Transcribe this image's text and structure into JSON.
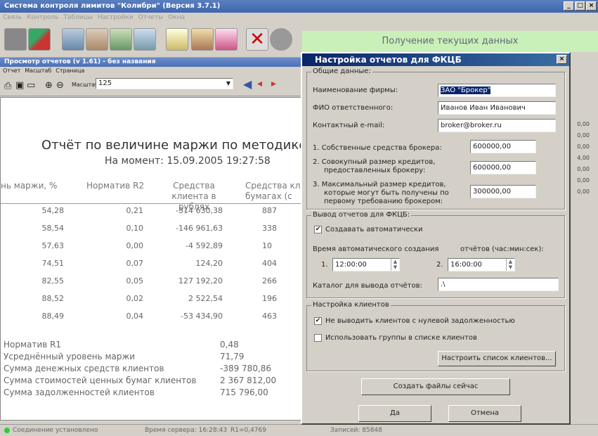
{
  "app": {
    "title": "Система контроля лимитов \"Колибри\" (Версия 3.7.1)"
  },
  "menu": [
    "Связь",
    "Контроль",
    "Таблицы",
    "Настройки",
    "Отчеты",
    "Окна"
  ],
  "status_message": "Получение текущих данных",
  "report_window": {
    "title": "Просмотр отчетов (v 1.61) - без названия",
    "menu": [
      "Отчет",
      "Масштаб",
      "Страница"
    ],
    "zoom_label": "Масштаб",
    "zoom_value": "125",
    "report_title": "Отчёт по величине маржи по методике Ф",
    "report_subtitle": "На момент: 15.09.2005 19:27:58",
    "columns": [
      "нь маржи, %",
      "Норматив R2",
      "Средства клиента в рублях",
      "Средства кл в бумагах (с"
    ],
    "rows": [
      [
        "54,28",
        "0,21",
        "-314 630,38",
        "887"
      ],
      [
        "58,54",
        "0,10",
        "-146 961,63",
        "338"
      ],
      [
        "57,63",
        "0,00",
        "-4 592,89",
        "10"
      ],
      [
        "74,51",
        "0,07",
        "124,20",
        "404"
      ],
      [
        "82,55",
        "0,05",
        "127 192,20",
        "266"
      ],
      [
        "88,52",
        "0,02",
        "2 522,54",
        "196"
      ],
      [
        "88,49",
        "0,04",
        "-53 434,90",
        "463"
      ]
    ],
    "summary": [
      {
        "label": "Норматив R1",
        "value": "0,48"
      },
      {
        "label": "Усреднённый уровень маржи",
        "value": "71,79"
      },
      {
        "label": "Сумма денежных средств клиентов",
        "value": "-389 780,86"
      },
      {
        "label": "Сумма стоимостей ценных бумаг клиентов",
        "value": "2 367 812,00"
      },
      {
        "label": "Сумма задолженностей клиентов",
        "value": "715 796,00"
      }
    ]
  },
  "side_values": [
    "0,00",
    "0,00",
    "0,00",
    "4,00",
    "0,00",
    "0,00",
    "0,00"
  ],
  "footer": {
    "connection": "Соединение установлено",
    "server_time": "Время сервера: 16:28:43",
    "r1": "R1=0,4769",
    "records": "Записей: 85848"
  },
  "dialog": {
    "title": "Настройка отчетов для ФКЦБ",
    "general_group": "Общие данные:",
    "company_label": "Наименование фирмы:",
    "company_value": "ЗАО \"Брокер\"",
    "responsible_label": "ФИО ответственного:",
    "responsible_value": "Иванов Иван Иванович",
    "email_label": "Контактный e-mail:",
    "email_value": "broker@broker.ru",
    "own_funds_label": "1. Собственные средства брокера:",
    "own_funds_value": "600000,00",
    "credits_label_1": "2. Совокупный размер кредитов,",
    "credits_label_2": "предоставленных брокеру:",
    "credits_value": "600000,00",
    "max_credits_label_1": "3. Максимальный размер кредитов,",
    "max_credits_label_2": "которые могут быть получены по",
    "max_credits_label_3": "первому требованию брокером:",
    "max_credits_value": "300000,00",
    "output_group": "Вывод отчетов для ФКЦБ:",
    "auto_create_label": "Создавать автоматически",
    "auto_create_checked": "✔",
    "time_label": "Время автоматического создания",
    "time_format_label": "отчётов (час:мин:сек):",
    "time1_num": "1.",
    "time1_value": "12:00:00",
    "time2_num": "2.",
    "time2_value": "16:00:00",
    "dir_label": "Каталог для вывода отчётов:",
    "dir_value": ".\\",
    "clients_group": "Настройка клиентов",
    "no_zero_debt_label": "Не выводить клиентов с нулевой задолженностью",
    "no_zero_debt_checked": "✔",
    "use_groups_label": "Использовать группы в списке клиентов",
    "use_groups_checked": "",
    "setup_clients_button": "Настроить список клиентов...",
    "create_now_button": "Создать файлы сейчас",
    "ok_button": "Да",
    "cancel_button": "Отмена"
  }
}
